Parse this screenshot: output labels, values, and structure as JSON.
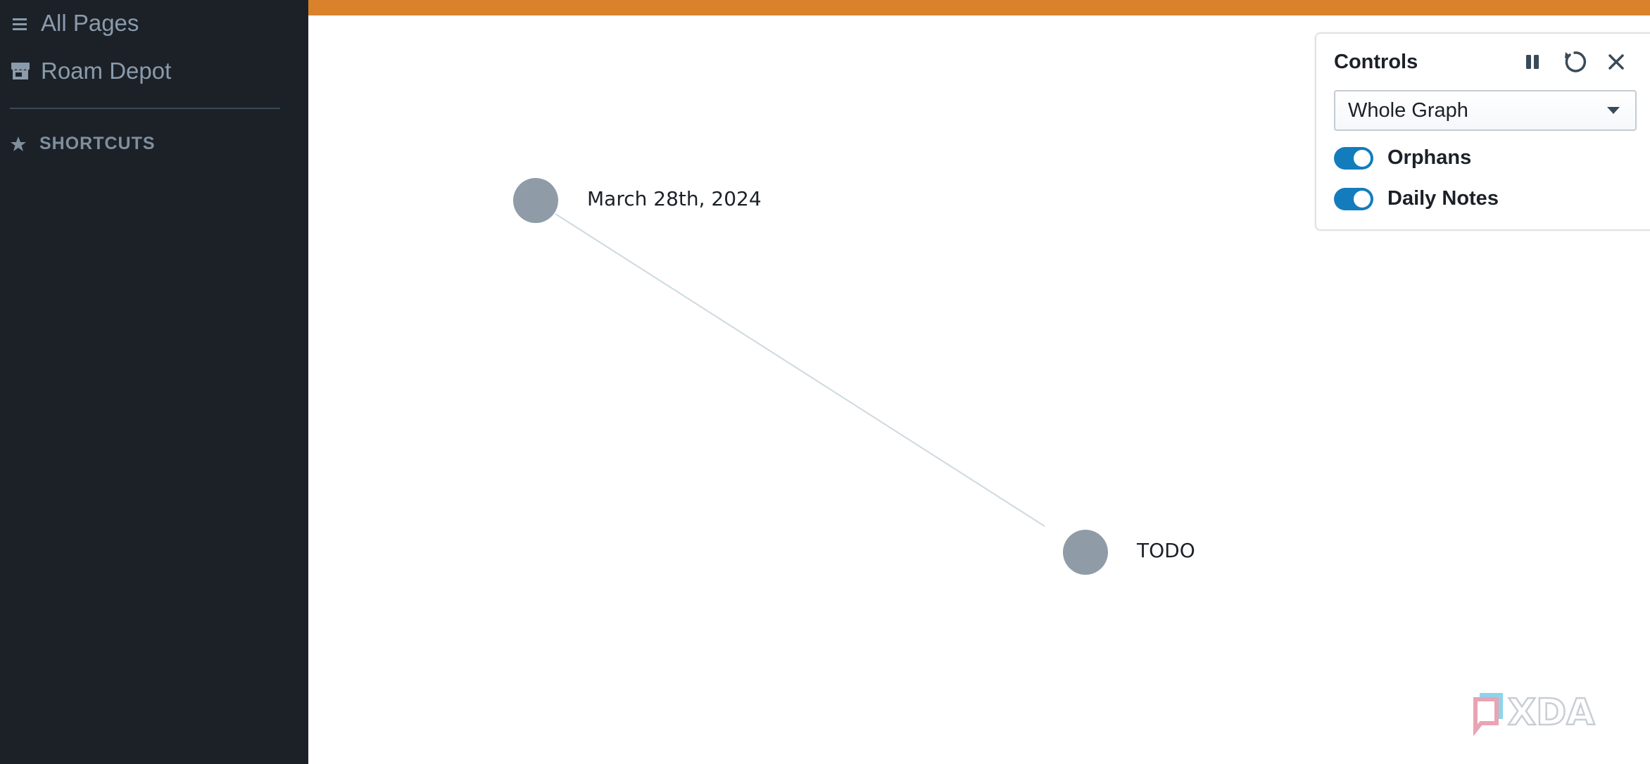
{
  "sidebar": {
    "items": [
      {
        "label": "All Pages",
        "icon": "list-icon"
      },
      {
        "label": "Roam Depot",
        "icon": "store-icon"
      }
    ],
    "shortcuts_label": "SHORTCUTS",
    "shortcuts_icon": "star-icon"
  },
  "topbar": {
    "color": "#d9822b"
  },
  "graph": {
    "nodes": [
      {
        "label": "March 28th, 2024"
      },
      {
        "label": "TODO"
      }
    ],
    "edges": [
      [
        "March 28th, 2024",
        "TODO"
      ]
    ],
    "node_color": "#8f9ca8",
    "edge_color": "#ced9e0"
  },
  "controls": {
    "title": "Controls",
    "buttons": [
      "pause-icon",
      "reset-icon",
      "close-icon"
    ],
    "select_value": "Whole Graph",
    "toggles": [
      {
        "label": "Orphans",
        "on": true
      },
      {
        "label": "Daily Notes",
        "on": true
      }
    ],
    "accent": "#137cbd"
  },
  "watermark": {
    "text": "XDA"
  }
}
